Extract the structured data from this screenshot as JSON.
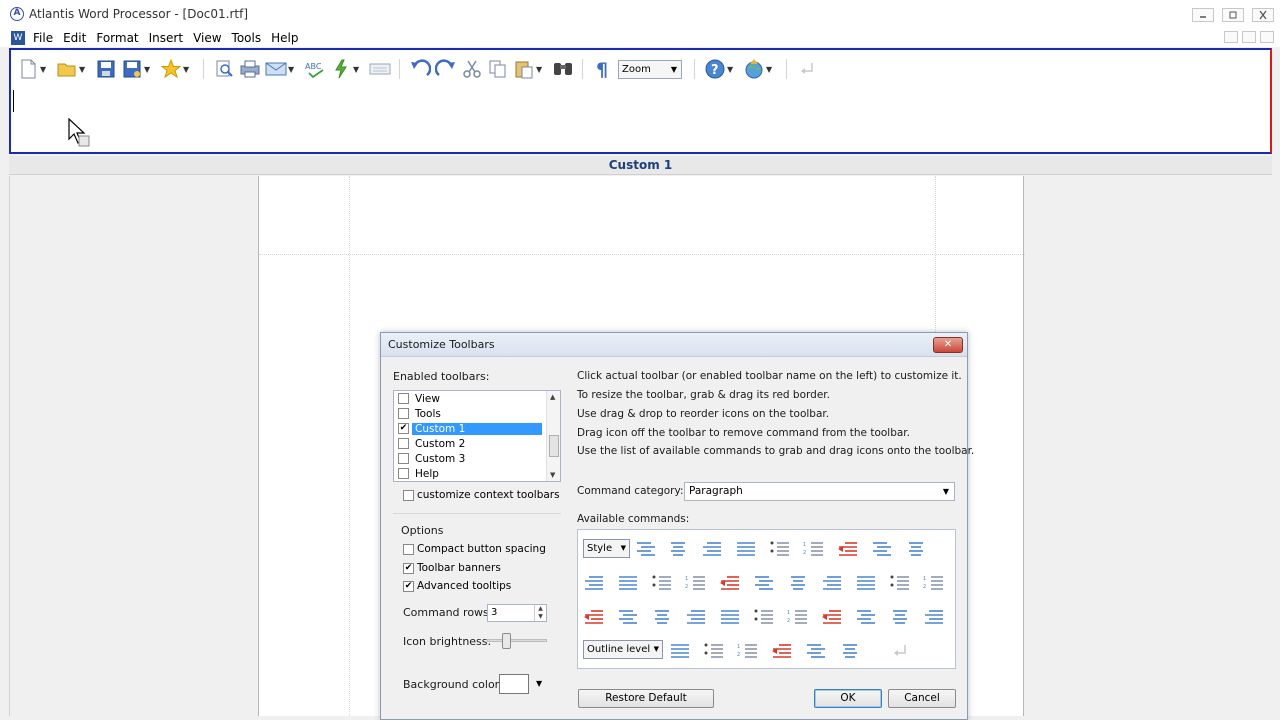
{
  "window": {
    "title": "Atlantis Word Processor - [Doc01.rtf]",
    "app_icon_glyph": "A",
    "doc_icon_glyph": "W"
  },
  "menu": [
    "File",
    "Edit",
    "Format",
    "Insert",
    "View",
    "Tools",
    "Help"
  ],
  "toolbar": {
    "zoom_label": "Zoom",
    "icons": [
      "new-document-icon",
      "open-folder-icon",
      "save-icon",
      "save-as-icon",
      "favorites-star-icon",
      "print-preview-icon",
      "print-icon",
      "email-icon",
      "spell-check-icon",
      "quick-action-icon",
      "keyboard-icon",
      "undo-icon",
      "redo-icon",
      "cut-icon",
      "copy-icon",
      "paste-icon",
      "find-icon",
      "paragraph-marks-icon",
      "help-icon",
      "web-icon",
      "return-icon"
    ]
  },
  "banner": {
    "label": "Custom 1"
  },
  "dialog": {
    "title": "Customize Toolbars",
    "close_label": "✕",
    "enabled_toolbars_label": "Enabled toolbars:",
    "toolbars": [
      {
        "label": "View",
        "checked": false,
        "selected": false
      },
      {
        "label": "Tools",
        "checked": false,
        "selected": false
      },
      {
        "label": "Custom 1",
        "checked": true,
        "selected": true
      },
      {
        "label": "Custom 2",
        "checked": false,
        "selected": false
      },
      {
        "label": "Custom 3",
        "checked": false,
        "selected": false
      },
      {
        "label": "Help",
        "checked": false,
        "selected": false
      }
    ],
    "customize_context_label": "customize context toolbars",
    "options_label": "Options",
    "compact_label": "Compact button spacing",
    "banners_label": "Toolbar banners",
    "tooltips_label": "Advanced tooltips",
    "command_rows_label": "Command rows:",
    "command_rows_value": "3",
    "icon_brightness_label": "Icon brightness:",
    "icon_brightness_level": 0.3,
    "background_color_label": "Background color:",
    "background_color": "#ffffff",
    "instructions": [
      "Click actual toolbar (or enabled toolbar name on the left) to customize it.",
      "To resize the toolbar, grab & drag its red border.",
      "Use drag & drop to reorder icons on the toolbar.",
      "Drag icon off the toolbar to remove command from the toolbar.",
      "Use the list of available commands to grab and drag icons onto the toolbar."
    ],
    "command_category_label": "Command category:",
    "command_category_value": "Paragraph",
    "available_commands_label": "Available commands:",
    "style_select_label": "Style",
    "outline_select_label": "Outline level",
    "restore_label": "Restore Default",
    "ok_label": "OK",
    "cancel_label": "Cancel"
  },
  "colors": {
    "toolbar_border": "#1a2bb3",
    "resize_border": "#d81b1b",
    "selection": "#3399ff",
    "banner_text": "#1f3f7a"
  }
}
